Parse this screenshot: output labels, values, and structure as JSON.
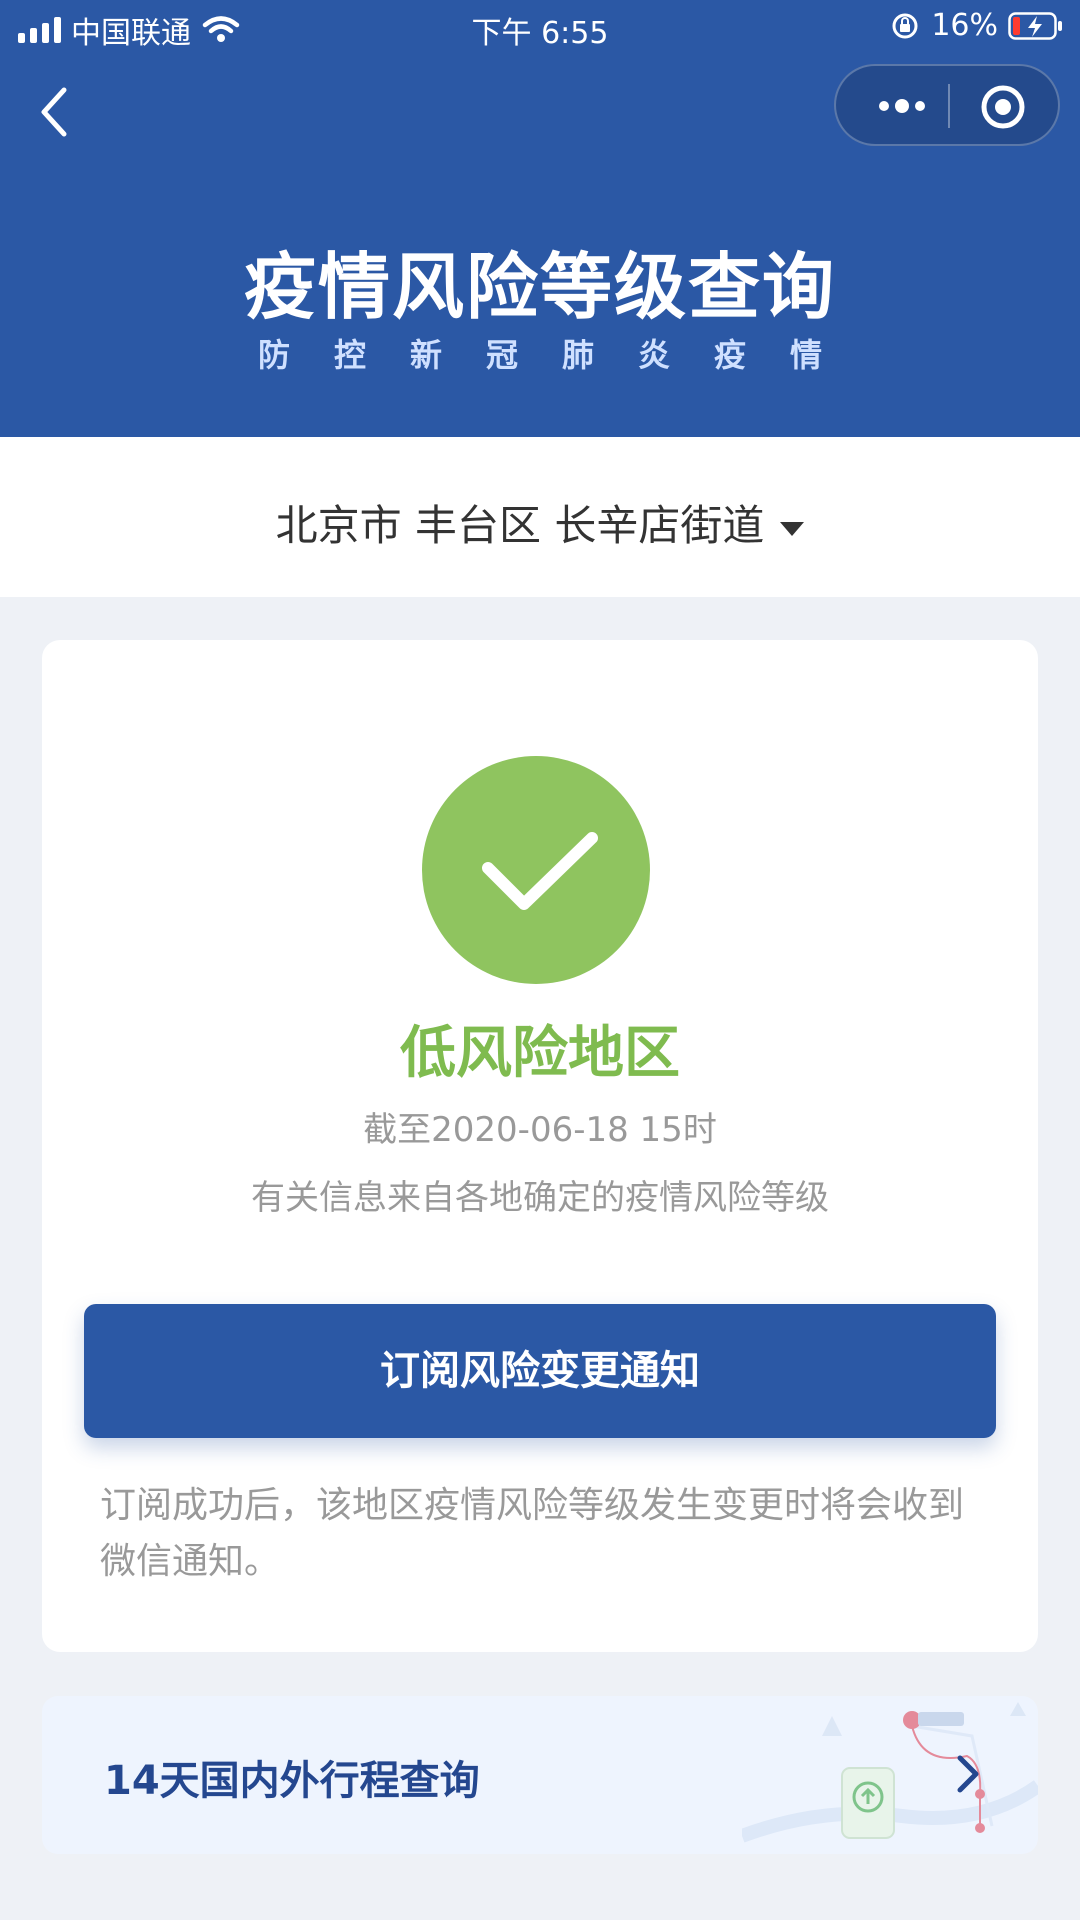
{
  "status_bar": {
    "carrier": "中国联通",
    "time": "下午 6:55",
    "battery_percent": "16%"
  },
  "header": {
    "title": "疫情风险等级查询",
    "subtitle": "防控新冠肺炎疫情"
  },
  "location": {
    "text": "北京市 丰台区 长辛店街道"
  },
  "result": {
    "level": "低风险地区",
    "as_of": "截至2020-06-18 15时",
    "source": "有关信息来自各地确定的疫情风险等级"
  },
  "subscribe": {
    "button_label": "订阅风险变更通知",
    "note": "订阅成功后，该地区疫情风险等级发生变更时将会收到微信通知。"
  },
  "trip_query": {
    "label": "14天国内外行程查询"
  },
  "colors": {
    "header_blue": "#2b58a5",
    "low_risk_green": "#8fc45f"
  },
  "icons": {
    "back": "back-chevron-icon",
    "more": "more-dots-icon",
    "target": "target-icon",
    "check": "checkmark-icon",
    "arrow": "chevron-right-icon"
  }
}
